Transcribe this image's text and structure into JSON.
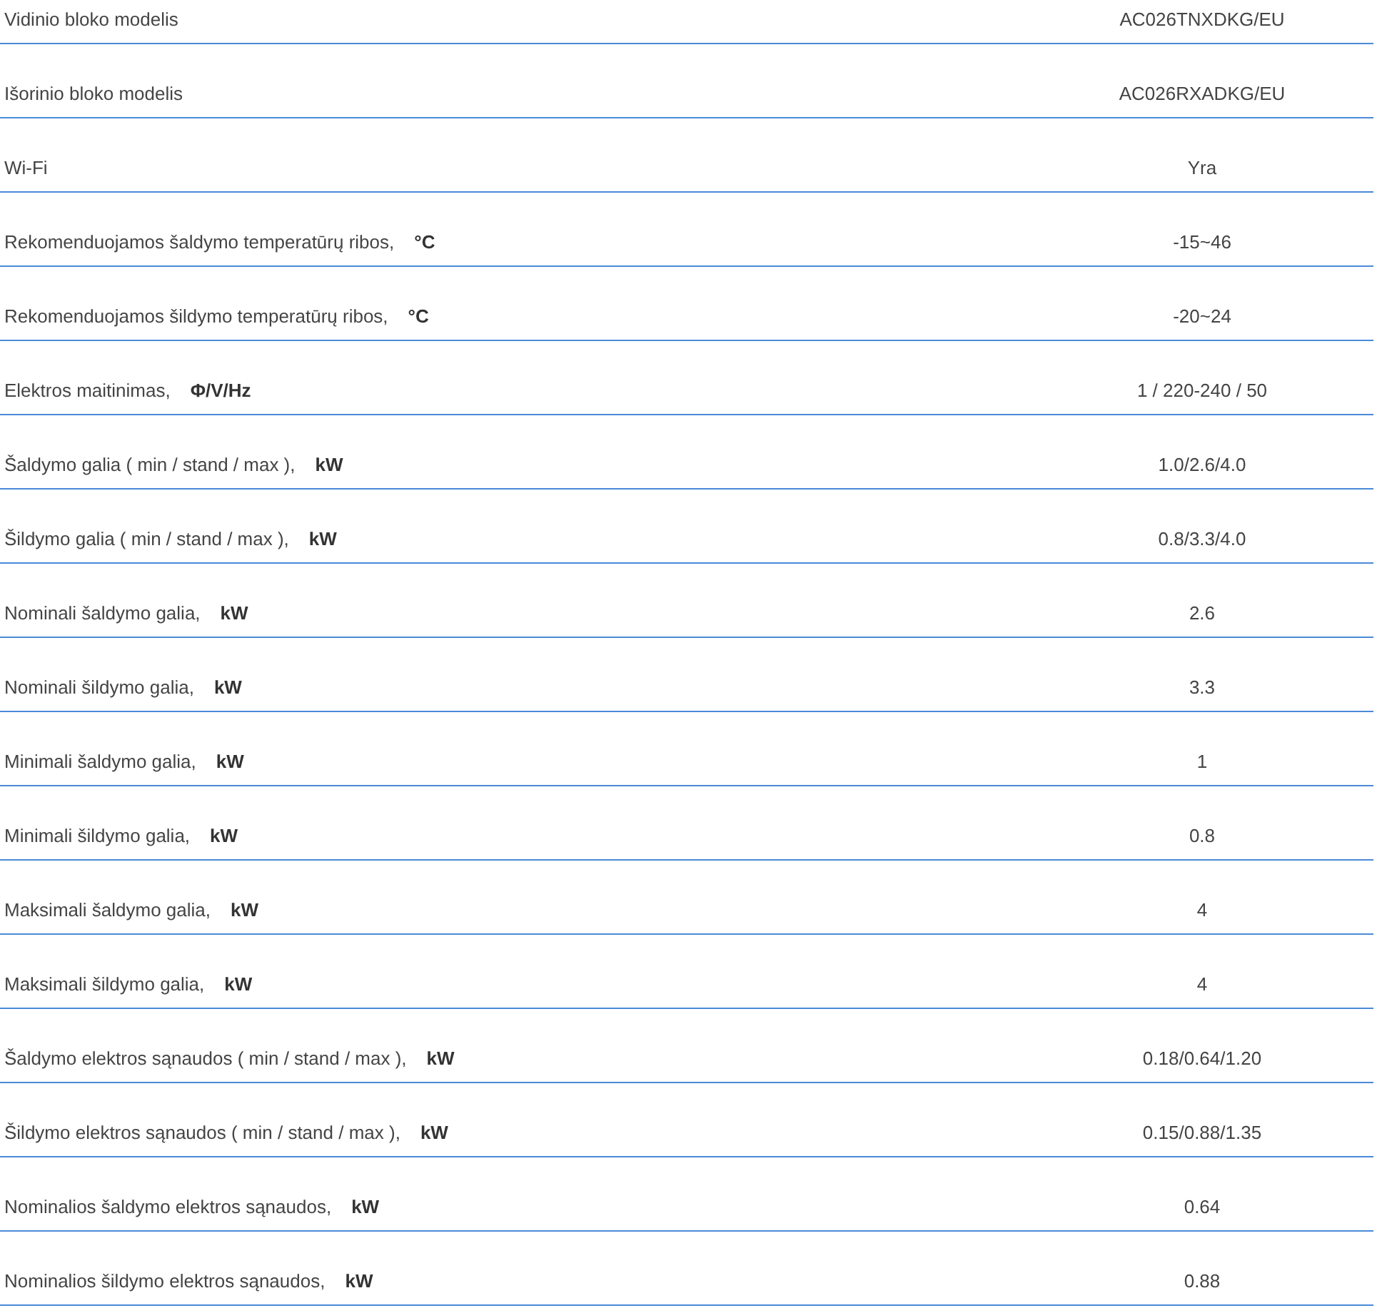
{
  "spec_rows": [
    {
      "label": "Vidinio bloko modelis",
      "value": "AC026TNXDKG/EU"
    },
    {
      "label": "Išorinio bloko modelis",
      "value": "AC026RXADKG/EU"
    },
    {
      "label": "Wi-Fi",
      "value": "Yra"
    },
    {
      "label": "Rekomenduojamos šaldymo temperatūrų ribos,",
      "unit": "°C",
      "value": "-15~46"
    },
    {
      "label": "Rekomenduojamos šildymo temperatūrų ribos,",
      "unit": "°C",
      "value": "-20~24"
    },
    {
      "label": "Elektros maitinimas,",
      "unit": "Φ/V/Hz",
      "value": "1 / 220-240 / 50"
    },
    {
      "label": "Šaldymo galia ( min / stand / max ),",
      "unit": "kW",
      "value": "1.0/2.6/4.0"
    },
    {
      "label": "Šildymo galia ( min / stand / max ),",
      "unit": "kW",
      "value": "0.8/3.3/4.0"
    },
    {
      "label": "Nominali šaldymo galia,",
      "unit": "kW",
      "value": "2.6"
    },
    {
      "label": "Nominali šildymo galia,",
      "unit": "kW",
      "value": "3.3"
    },
    {
      "label": "Minimali šaldymo galia,",
      "unit": "kW",
      "value": "1"
    },
    {
      "label": "Minimali šildymo galia,",
      "unit": "kW",
      "value": "0.8"
    },
    {
      "label": "Maksimali šaldymo galia,",
      "unit": "kW",
      "value": "4"
    },
    {
      "label": "Maksimali šildymo galia,",
      "unit": "kW",
      "value": "4"
    },
    {
      "label": "Šaldymo elektros sąnaudos ( min / stand / max ),",
      "unit": "kW",
      "value": "0.18/0.64/1.20"
    },
    {
      "label": "Šildymo elektros sąnaudos ( min / stand / max ),",
      "unit": "kW",
      "value": "0.15/0.88/1.35"
    },
    {
      "label": "Nominalios šaldymo elektros sąnaudos,",
      "unit": "kW",
      "value": "0.64"
    },
    {
      "label": "Nominalios šildymo elektros sąnaudos,",
      "unit": "kW",
      "value": "0.88"
    }
  ]
}
